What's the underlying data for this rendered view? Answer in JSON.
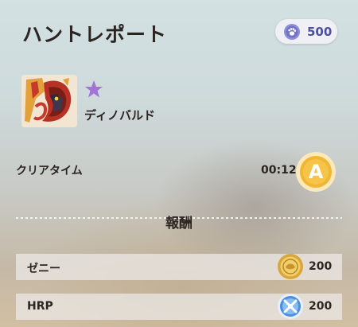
{
  "header": {
    "title": "ハントレポート"
  },
  "currency": {
    "icon": "paw-gem-icon",
    "value": "500",
    "color": "#4a4fa0"
  },
  "monster": {
    "name": "ディノバルド",
    "icon": "dinovaldo-monster-icon",
    "star_icon": "purple-star-icon",
    "star_color": "#a274d6"
  },
  "clear": {
    "label": "クリアタイム",
    "time": "00:12",
    "rank": "A",
    "rank_color": "#f0b634"
  },
  "rewards": {
    "title": "報酬",
    "items": [
      {
        "label": "ゼニー",
        "amount": "200",
        "icon": "zenny-coin-icon"
      },
      {
        "label": "HRP",
        "amount": "200",
        "icon": "hrp-emblem-icon"
      }
    ]
  }
}
